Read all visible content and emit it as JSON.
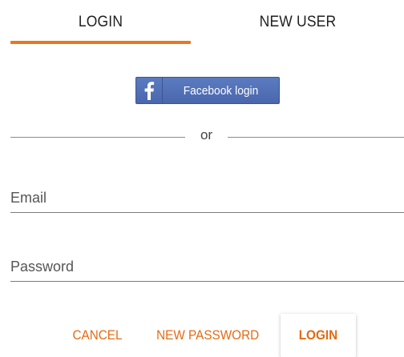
{
  "tabs": {
    "login": "LOGIN",
    "new_user": "NEW USER",
    "active": "login"
  },
  "facebook": {
    "label": "Facebook login",
    "icon": "facebook-f-icon"
  },
  "divider": {
    "text": "or"
  },
  "form": {
    "email": {
      "placeholder": "Email",
      "value": ""
    },
    "password": {
      "placeholder": "Password",
      "value": ""
    }
  },
  "actions": {
    "cancel": "CANCEL",
    "new_password": "NEW PASSWORD",
    "login": "LOGIN"
  },
  "colors": {
    "accent": "#e87722",
    "facebook": "#4a67ad"
  }
}
